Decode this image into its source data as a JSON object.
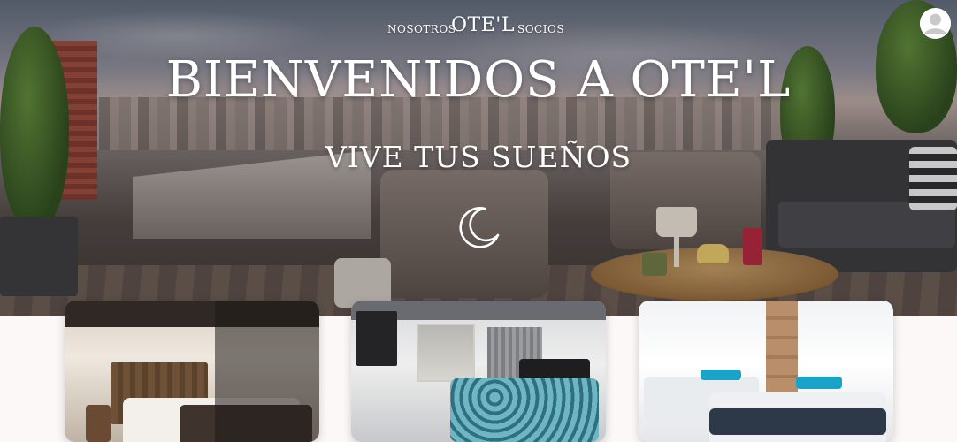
{
  "nav": {
    "left_link": "NOSOTROS",
    "brand": "OTE'L",
    "right_link": "SOCIOS"
  },
  "hero": {
    "title": "BIENVENIDOS A OTE'L",
    "subtitle": "VIVE TUS SUEÑOS"
  },
  "icons": {
    "moon": "moon-icon",
    "avatar": "user-avatar-icon"
  },
  "cards": [
    {
      "name": "room-card-1"
    },
    {
      "name": "room-card-2"
    },
    {
      "name": "room-card-3"
    }
  ],
  "colors": {
    "page_background": "#fcf8f7",
    "hero_text": "#ffffff"
  }
}
